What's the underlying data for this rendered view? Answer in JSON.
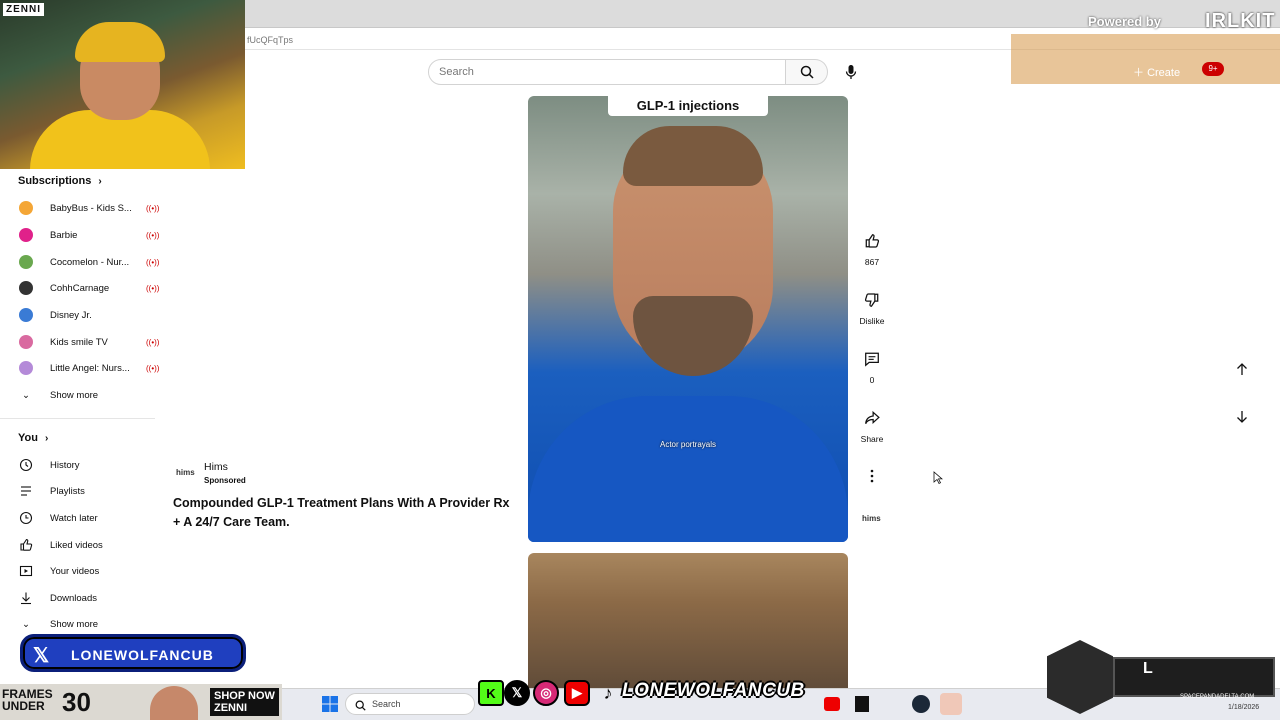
{
  "top": {
    "url_fragment": "fUcQFqTps",
    "powered_by": "Powered by",
    "overlay_brand": "IRLKIT"
  },
  "webcam": {
    "brand": "ZENNI"
  },
  "header": {
    "search_placeholder": "Search",
    "create_label": "Create",
    "notification_count": "9+"
  },
  "sidebar": {
    "subscriptions_title": "Subscriptions",
    "subscriptions": [
      {
        "name": "BabyBus - Kids S...",
        "color": "#f4a636"
      },
      {
        "name": "Barbie",
        "color": "#e0218a"
      },
      {
        "name": "Cocomelon - Nur...",
        "color": "#6aa84f"
      },
      {
        "name": "CohhCarnage",
        "color": "#333333"
      },
      {
        "name": "Disney Jr.",
        "color": "#3a7bd5"
      },
      {
        "name": "Kids smile TV",
        "color": "#d96aa0"
      },
      {
        "name": "Little Angel: Nurs...",
        "color": "#b48ad8"
      }
    ],
    "show_more": "Show more",
    "you_title": "You",
    "you_items": [
      {
        "label": "History",
        "icon": "history-icon"
      },
      {
        "label": "Playlists",
        "icon": "playlists-icon"
      },
      {
        "label": "Watch later",
        "icon": "clock-icon"
      },
      {
        "label": "Liked videos",
        "icon": "thumbs-up-icon"
      },
      {
        "label": "Your videos",
        "icon": "video-icon"
      },
      {
        "label": "Downloads",
        "icon": "download-icon"
      }
    ],
    "show_more_2": "Show more"
  },
  "ad": {
    "logo_text": "hims",
    "advertiser": "Hims",
    "sponsored": "Sponsored",
    "title": "Compounded GLP-1 Treatment Plans With A Provider Rx + A 24/7 Care Team."
  },
  "video": {
    "caption_top": "GLP-1 injections",
    "caption_mid": "Actor portrayals"
  },
  "actions": {
    "like_count": "867",
    "dislike_label": "Dislike",
    "comment_count": "0",
    "share_label": "Share",
    "channel_logo": "hims"
  },
  "bottom": {
    "x_handle": "LONEWOLFANCUB",
    "frames_line1": "FRAMES",
    "frames_line2": "UNDER",
    "frames_price": "30",
    "shop_now": "SHOP NOW",
    "shop_brand": "ZENNI",
    "social_handle": "LONEWOLFANCUB",
    "taskbar_search": "Search",
    "panda_letter": "L",
    "panda_site": "SPACEPANDADELTA.COM",
    "date": "1/18/2026"
  }
}
